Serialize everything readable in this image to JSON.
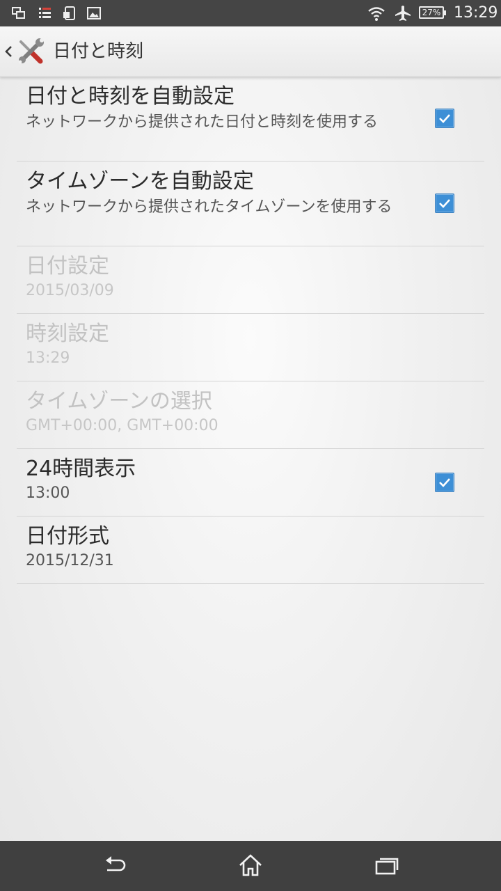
{
  "status_bar": {
    "notification_icons": [
      "screen-mirror-icon",
      "tasks-icon",
      "file-transfer-icon",
      "image-icon"
    ],
    "status_icons": [
      "wifi-icon",
      "airplane-mode-icon",
      "battery-icon"
    ],
    "battery_text": "27%",
    "time": "13:29"
  },
  "action_bar": {
    "up_icon": "chevron-left-icon",
    "app_icon": "settings-tools-icon",
    "title": "日付と時刻"
  },
  "settings": [
    {
      "title": "日付と時刻を自動設定",
      "summary": "ネットワークから提供された日付と時刻を使用する",
      "checked": true,
      "enabled": true
    },
    {
      "title": "タイムゾーンを自動設定",
      "summary": "ネットワークから提供されたタイムゾーンを使用する",
      "checked": true,
      "enabled": true
    },
    {
      "title": "日付設定",
      "summary": "2015/03/09",
      "enabled": false
    },
    {
      "title": "時刻設定",
      "summary": "13:29",
      "enabled": false
    },
    {
      "title": "タイムゾーンの選択",
      "summary": "GMT+00:00, GMT+00:00",
      "enabled": false
    },
    {
      "title": "24時間表示",
      "summary": "13:00",
      "checked": true,
      "enabled": true
    },
    {
      "title": "日付形式",
      "summary": "2015/12/31",
      "enabled": true
    }
  ],
  "nav_bar": {
    "buttons": [
      "back-icon",
      "home-icon",
      "recent-apps-icon"
    ]
  },
  "colors": {
    "accent": "#3d8fd6",
    "status_bar_bg": "#454545",
    "nav_bar_bg": "#404040",
    "disabled_text": "#c2c2c2"
  }
}
